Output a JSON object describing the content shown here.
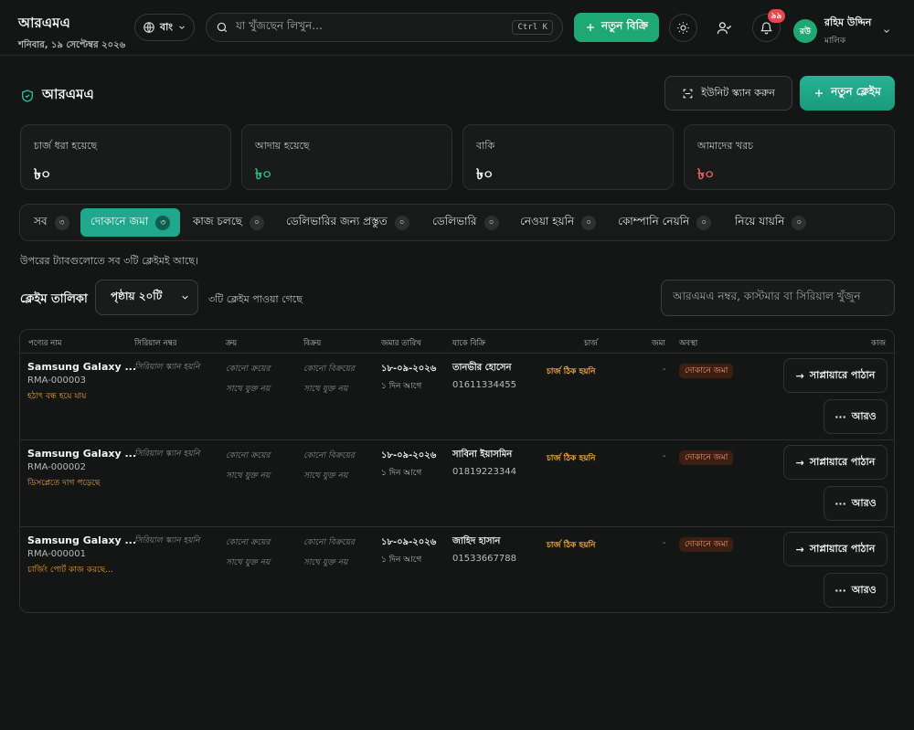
{
  "header": {
    "app_name": "আরএমএ",
    "date": "শনিবার, ১৯ সেপ্টেম্বর ২০২৬",
    "language": "বাং",
    "search_placeholder": "যা খুঁজছেন লিখুন...",
    "search_shortcut": "Ctrl K",
    "new_sale_label": "নতুন বিক্রি",
    "notification_count": "৯৯",
    "user_initials": "রউ",
    "user_name": "রহিম উদ্দিন",
    "user_role": "মালিক"
  },
  "page": {
    "title": "আরএমএ",
    "scan_button": "ইউনিট স্ক্যান করুন",
    "new_claim_button": "নতুন ক্লেইম"
  },
  "stats": [
    {
      "label": "চার্জ ধরা হয়েছে",
      "value": "৳০",
      "color": "#f2f4f3"
    },
    {
      "label": "আদায় হয়েছে",
      "value": "৳০",
      "color": "#2dbf7b"
    },
    {
      "label": "বাকি",
      "value": "৳০",
      "color": "#f2f4f3"
    },
    {
      "label": "আমাদের খরচ",
      "value": "৳০",
      "color": "#ef5d5d"
    }
  ],
  "tabs": [
    {
      "label": "সব",
      "count": "৩"
    },
    {
      "label": "দোকানে জমা",
      "count": "৩",
      "active": true
    },
    {
      "label": "কাজ চলছে",
      "count": "০"
    },
    {
      "label": "ডেলিভারির জন্য প্রস্তুত",
      "count": "০"
    },
    {
      "label": "ডেলিভারি",
      "count": "০"
    },
    {
      "label": "নেওয়া হয়নি",
      "count": "০"
    },
    {
      "label": "কোম্পানি নেয়নি",
      "count": "০"
    },
    {
      "label": "নিয়ে যায়নি",
      "count": "০"
    }
  ],
  "note": "উপরের ট্যাবগুলোতে সব ৩টি ক্লেইমই আছে।",
  "list": {
    "title": "ক্লেইম তালিকা",
    "per_page": "পৃষ্ঠায় ২০টি",
    "found": "৩টি ক্লেইম পাওয়া গেছে",
    "search_placeholder": "আরএমএ নম্বর, কাস্টমার বা সিরিয়াল খুঁজুন"
  },
  "columns": [
    "পণ্যের নাম",
    "সিরিয়াল নম্বর",
    "ক্রয়",
    "বিক্রয়",
    "জমার তারিখ",
    "যাকে বিক্রি",
    "চার্জ",
    "জমা",
    "অবস্থা",
    "কাজ"
  ],
  "rows": [
    {
      "product": "Samsung Galaxy ...",
      "rma": "RMA-000003",
      "issue": "হঠাৎ বন্ধ হয়ে যায়",
      "serial": "সিরিয়াল স্ক্যান হয়নি",
      "purchase": [
        "কোনো ক্রয়ের",
        "সাথে যুক্ত নয়"
      ],
      "sale": [
        "কোনো বিক্রয়ের",
        "সাথে যুক্ত নয়"
      ],
      "date": "১৮-০৯-২০২৬",
      "ago": "১ দিন আগে",
      "customer": "তানভীর হোসেন",
      "phone": "01611334455",
      "charge": "চার্জ ঠিক হয়নি",
      "deposit": "-",
      "status": "দোকানে জমা",
      "action_primary": "সাপ্লায়ারে পাঠান",
      "action_more": "আরও"
    },
    {
      "product": "Samsung Galaxy ...",
      "rma": "RMA-000002",
      "issue": "ডিসপ্লেতে দাগ পড়েছে",
      "serial": "সিরিয়াল স্ক্যান হয়নি",
      "purchase": [
        "কোনো ক্রয়ের",
        "সাথে যুক্ত নয়"
      ],
      "sale": [
        "কোনো বিক্রয়ের",
        "সাথে যুক্ত নয়"
      ],
      "date": "১৮-০৯-২০২৬",
      "ago": "১ দিন আগে",
      "customer": "সাবিনা ইয়াসমিন",
      "phone": "01819223344",
      "charge": "চার্জ ঠিক হয়নি",
      "deposit": "-",
      "status": "দোকানে জমা",
      "action_primary": "সাপ্লায়ারে পাঠান",
      "action_more": "আরও"
    },
    {
      "product": "Samsung Galaxy ...",
      "rma": "RMA-000001",
      "issue": "চার্জিং পোর্ট কাজ করছে...",
      "serial": "সিরিয়াল স্ক্যান হয়নি",
      "purchase": [
        "কোনো ক্রয়ের",
        "সাথে যুক্ত নয়"
      ],
      "sale": [
        "কোনো বিক্রয়ের",
        "সাথে যুক্ত নয়"
      ],
      "date": "১৮-০৯-২০২৬",
      "ago": "১ দিন আগে",
      "customer": "জাহিদ হাসান",
      "phone": "01533667788",
      "charge": "চার্জ ঠিক হয়নি",
      "deposit": "-",
      "status": "দোকানে জমা",
      "action_primary": "সাপ্লায়ারে পাঠান",
      "action_more": "আরও"
    }
  ]
}
